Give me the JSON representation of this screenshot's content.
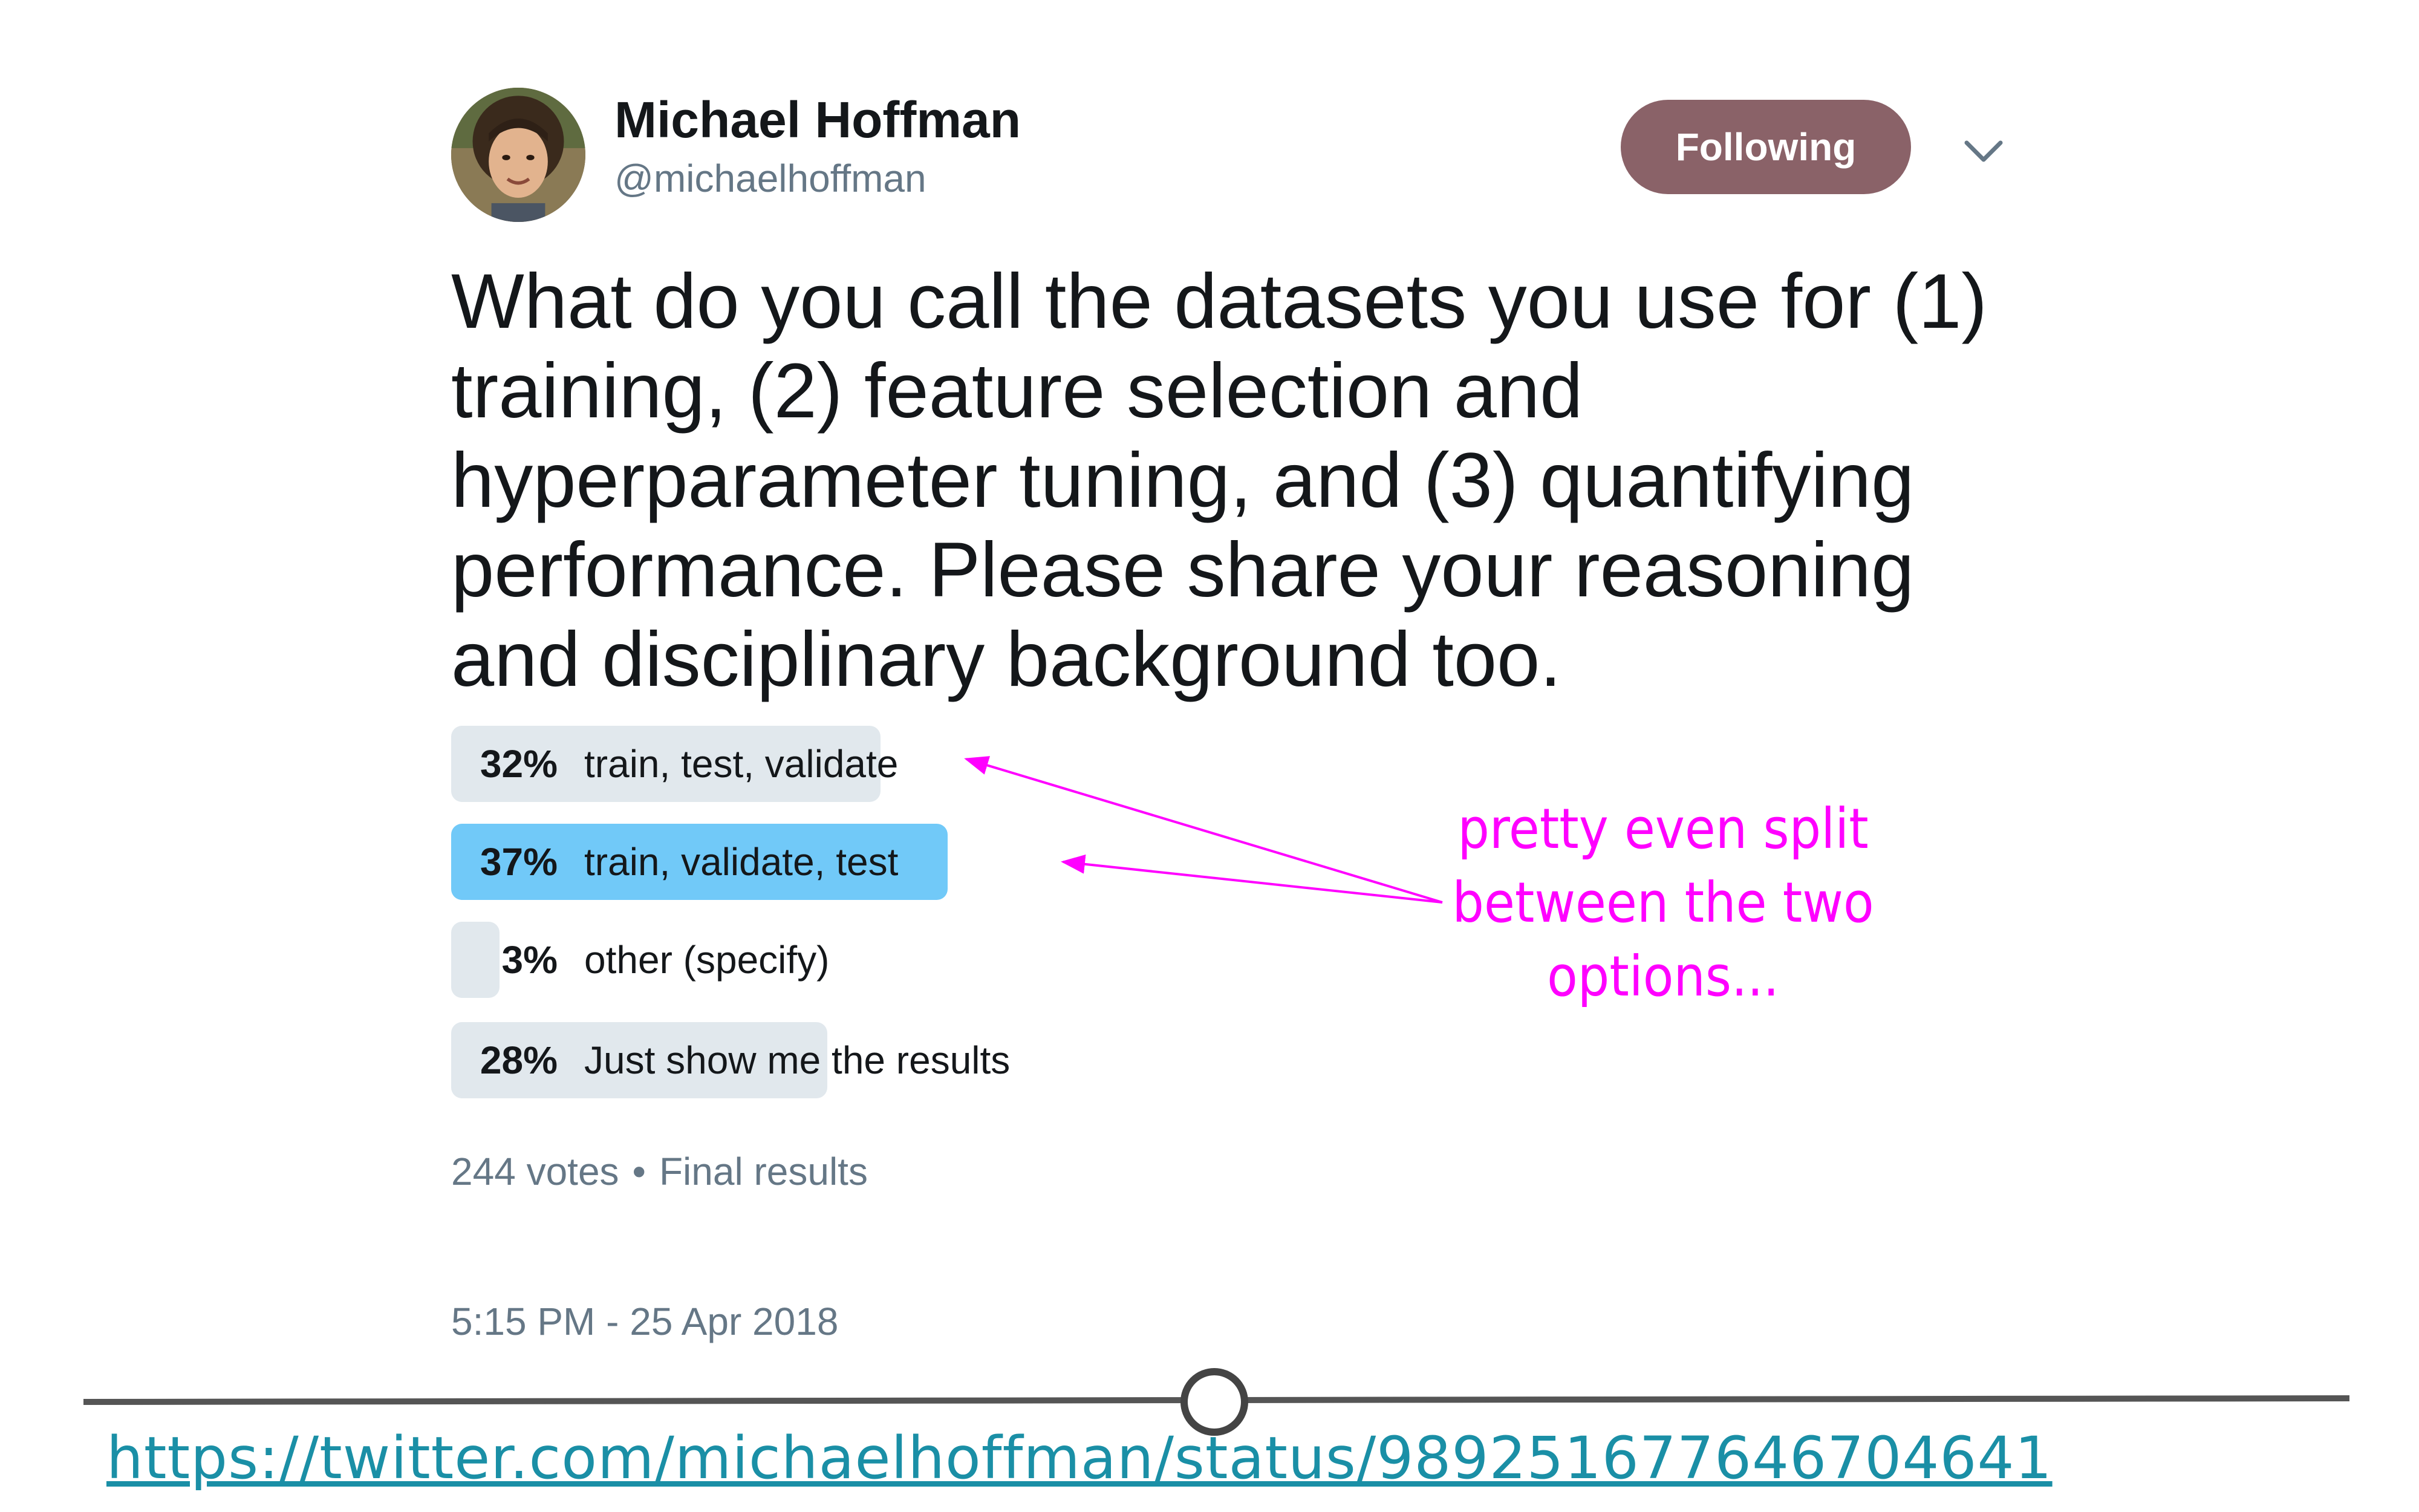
{
  "tweet": {
    "author": {
      "display_name": "Michael Hoffman",
      "handle": "@michaelhoffman",
      "avatar": "user-photo"
    },
    "follow_button_label": "Following",
    "text_lines": [
      "What do you call the datasets you use for (1)",
      "training, (2) feature selection and",
      "hyperparameter tuning, and (3) quantifying",
      "performance. Please share your reasoning",
      "and disciplinary background too."
    ],
    "poll": {
      "options": [
        {
          "percent_label": "32%",
          "percent": 32,
          "label": "train, test, validate",
          "winner": false
        },
        {
          "percent_label": "37%",
          "percent": 37,
          "label": "train, validate, test",
          "winner": true
        },
        {
          "percent_label": "3%",
          "percent": 3,
          "label": "other (specify)",
          "winner": false
        },
        {
          "percent_label": "28%",
          "percent": 28,
          "label": "Just show me the results",
          "winner": false
        }
      ],
      "votes": "244 votes",
      "separator": "•",
      "status": "Final results"
    },
    "timestamp": "5:15 PM - 25 Apr 2018"
  },
  "annotation": {
    "lines": [
      "pretty even split",
      "between the two",
      "options..."
    ],
    "color": "#ff00ff"
  },
  "source_link": "https://twitter.com/michaelhoffman/status/989251677646704641",
  "colors": {
    "follow_button": "#8a6268",
    "poll_winner": "#71c9f8",
    "poll_bar": "#e1e8ed",
    "link": "#1a8fa6"
  }
}
